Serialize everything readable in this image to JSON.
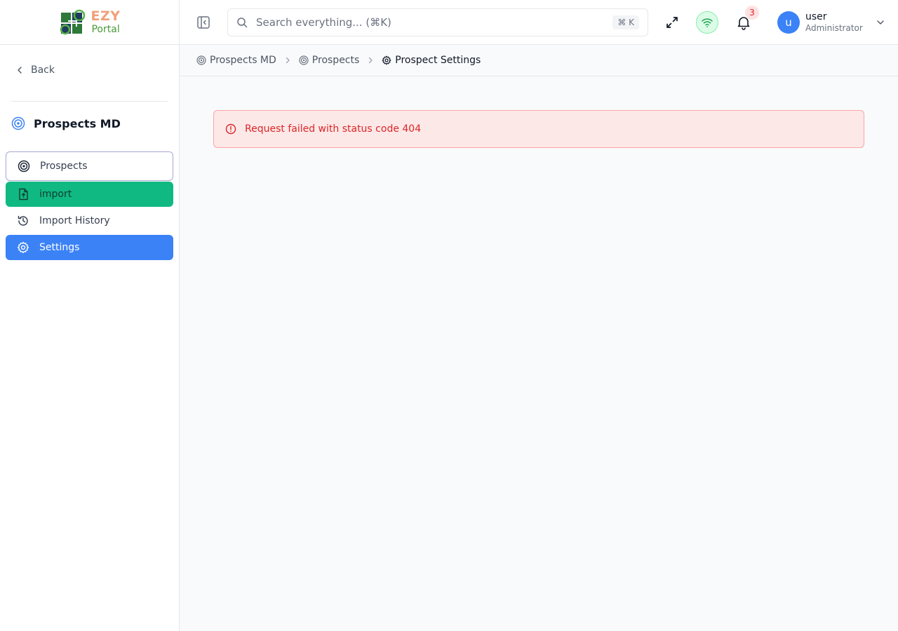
{
  "brand": {
    "line1": "EZY",
    "line2": "Portal"
  },
  "sidebar": {
    "back_label": "Back",
    "module_title": "Prospects MD",
    "items": [
      {
        "label": "Prospects"
      },
      {
        "label": "import"
      },
      {
        "label": "Import History"
      },
      {
        "label": "Settings"
      }
    ]
  },
  "header": {
    "search_placeholder": "Search everything... (⌘K)",
    "search_shortcut": "⌘ K",
    "notification_count": "3",
    "user_initial": "u",
    "user_name": "user",
    "user_role": "Administrator"
  },
  "breadcrumb": [
    {
      "label": "Prospects MD"
    },
    {
      "label": "Prospects"
    },
    {
      "label": "Prospect Settings"
    }
  ],
  "alert": {
    "message": "Request failed with status code 404"
  },
  "colors": {
    "accent_blue": "#3b82f6",
    "accent_green": "#10b981",
    "error_red": "#dc2626"
  }
}
